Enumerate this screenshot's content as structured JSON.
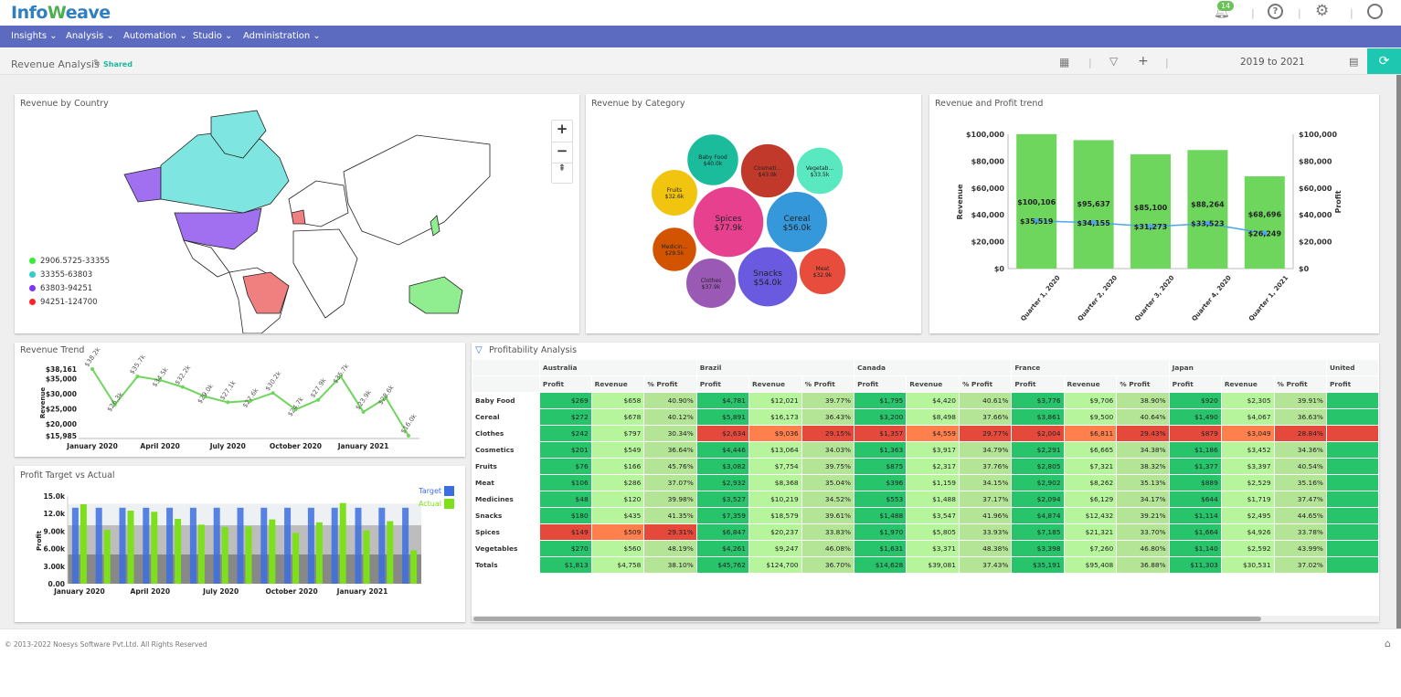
{
  "app": {
    "logo_text": "InfoWeave",
    "notification_count": "14",
    "icons": [
      "bell-icon",
      "help-icon",
      "settings-icon",
      "user-icon"
    ]
  },
  "nav": [
    "Insights",
    "Analysis",
    "Automation",
    "Studio",
    "Administration"
  ],
  "toolbar": {
    "title": "Revenue Analysis",
    "shared_label": "Shared",
    "date_range": "2019 to 2021",
    "icons": [
      "grid-icon",
      "filter-icon",
      "plus-icon",
      "calendar-icon",
      "refresh-icon"
    ]
  },
  "colors": {
    "nav": "#5c6bc0",
    "accent": "#1ec8b0",
    "revenue_bar": "#6ed65c",
    "profit_line": "#4da6e8",
    "target": "#3b6fe0",
    "actual": "#7ee01c"
  },
  "map": {
    "title": "Revenue by Country",
    "legend": [
      {
        "label": "2906.5725-33355",
        "color": "#33ee33"
      },
      {
        "label": "33355-63803",
        "color": "#33cccc"
      },
      {
        "label": "63803-94251",
        "color": "#7f33ff"
      },
      {
        "label": "94251-124700",
        "color": "#ff2222"
      }
    ],
    "zoom_in": "+",
    "zoom_out": "−"
  },
  "bubble": {
    "title": "Revenue by Category",
    "chart_data": {
      "type": "bubble",
      "items": [
        {
          "label": "Spices",
          "value_label": "$77.9k",
          "value": 77.9,
          "color": "#e6408f"
        },
        {
          "label": "Cereal",
          "value_label": "$56.0k",
          "value": 56.0,
          "color": "#3498db"
        },
        {
          "label": "Snacks",
          "value_label": "$54.0k",
          "value": 54.0,
          "color": "#6a5ae0"
        },
        {
          "label": "Cosmeti...",
          "value_label": "$43.9k",
          "value": 43.9,
          "color": "#c0392b"
        },
        {
          "label": "Baby Food",
          "value_label": "$40.0k",
          "value": 40.0,
          "color": "#1abc9c"
        },
        {
          "label": "Clothes",
          "value_label": "$37.9k",
          "value": 37.9,
          "color": "#9b59b6"
        },
        {
          "label": "Vegetab...",
          "value_label": "$33.5k",
          "value": 33.5,
          "color": "#5ae8c0"
        },
        {
          "label": "Meat",
          "value_label": "$32.9k",
          "value": 32.9,
          "color": "#e74c3c"
        },
        {
          "label": "Fruits",
          "value_label": "$32.6k",
          "value": 32.6,
          "color": "#f1c40f"
        },
        {
          "label": "Medicin...",
          "value_label": "$29.5k",
          "value": 29.5,
          "color": "#d35400"
        }
      ]
    }
  },
  "combo": {
    "title": "Revenue and Profit trend",
    "chart_data": {
      "type": "bar+line",
      "categories": [
        "Quarter 1, 2020",
        "Quarter 2, 2020",
        "Quarter 3, 2020",
        "Quarter 4, 2020",
        "Quarter 1, 2021"
      ],
      "series": [
        {
          "name": "Revenue",
          "type": "bar",
          "values": [
            100106,
            95637,
            85100,
            88264,
            68696
          ],
          "labels": [
            "$100,106",
            "$95,637",
            "$85,100",
            "$88,264",
            "$68,696"
          ]
        },
        {
          "name": "Profit",
          "type": "line",
          "values": [
            35519,
            34155,
            31273,
            33523,
            26249
          ],
          "labels": [
            "$35,519",
            "$34,155",
            "$31,273",
            "$33,523",
            "$26,249"
          ]
        }
      ],
      "ylabel": "Revenue",
      "y2label": "Profit",
      "ylim": [
        0,
        100000
      ],
      "yticks": [
        "$0",
        "$20,000",
        "$40,000",
        "$60,000",
        "$80,000",
        "$100,000"
      ]
    }
  },
  "trend": {
    "title": "Revenue Trend",
    "chart_data": {
      "type": "line",
      "x": [
        "2020-01",
        "2020-02",
        "2020-03",
        "2020-04",
        "2020-05",
        "2020-06",
        "2020-07",
        "2020-08",
        "2020-09",
        "2020-10",
        "2020-11",
        "2020-12",
        "2021-01",
        "2021-02",
        "2021-03"
      ],
      "values": [
        38161,
        26300,
        35700,
        34500,
        32200,
        29000,
        27100,
        27600,
        30200,
        24700,
        27900,
        35700,
        23900,
        28600,
        15985
      ],
      "labels": [
        "$38.2k",
        "$26.3k",
        "$35.7k",
        "$34.5k",
        "$32.2k",
        "$29.0k",
        "$27.1k",
        "$27.6k",
        "$30.2k",
        "$24.7k",
        "$27.9k",
        "$35.7k",
        "$23.9k",
        "$28.6k",
        "$16.0k"
      ],
      "ylabel": "Revenue",
      "ylim": [
        15985,
        38161
      ],
      "yticks": [
        "$15,985",
        "$20,000",
        "$25,000",
        "$30,000",
        "$35,000",
        "$38,161"
      ],
      "xticks": [
        "January 2020",
        "April 2020",
        "July 2020",
        "October 2020",
        "January 2021"
      ]
    }
  },
  "target": {
    "title": "Profit Target vs Actual",
    "chart_data": {
      "type": "bar",
      "x": [
        "2020-01",
        "2020-02",
        "2020-03",
        "2020-04",
        "2020-05",
        "2020-06",
        "2020-07",
        "2020-08",
        "2020-09",
        "2020-10",
        "2020-11",
        "2020-12",
        "2021-01",
        "2021-02",
        "2021-03"
      ],
      "series": [
        {
          "name": "Target",
          "values": [
            13000,
            13000,
            13000,
            13000,
            13000,
            13000,
            13000,
            13000,
            13000,
            13000,
            13000,
            13000,
            13000,
            13000,
            13000
          ]
        },
        {
          "name": "Actual",
          "values": [
            13600,
            9200,
            12500,
            12300,
            11100,
            10100,
            9700,
            9800,
            11000,
            8700,
            10500,
            13800,
            9100,
            10700,
            5700
          ]
        }
      ],
      "bands": [
        [
          0,
          5000
        ],
        [
          5000,
          10000
        ],
        [
          10000,
          13700
        ]
      ],
      "ylabel": "Profit",
      "ylim": [
        0,
        15000
      ],
      "yticks": [
        "0.00",
        "3.00k",
        "6.00k",
        "9.00k",
        "12.0k",
        "15.0k"
      ],
      "xticks": [
        "January 2020",
        "April 2020",
        "July 2020",
        "October 2020",
        "January 2021"
      ]
    }
  },
  "table": {
    "title": "Profitability Analysis",
    "countries": [
      "Australia",
      "Brazil",
      "Canada",
      "France",
      "Japan",
      "United"
    ],
    "subcols": [
      "Profit",
      "Revenue",
      "% Profit"
    ],
    "rows": [
      {
        "label": "Baby Food",
        "cells": [
          "$269",
          "$658",
          "40.90%",
          "$4,781",
          "$12,021",
          "39.77%",
          "$1,795",
          "$4,420",
          "40.61%",
          "$3,776",
          "$9,706",
          "38.90%",
          "$920",
          "$2,305",
          "39.91%",
          ""
        ]
      },
      {
        "label": "Cereal",
        "cells": [
          "$272",
          "$678",
          "40.12%",
          "$5,891",
          "$16,173",
          "36.43%",
          "$3,200",
          "$8,498",
          "37.66%",
          "$3,861",
          "$9,500",
          "40.64%",
          "$1,490",
          "$4,067",
          "36.63%",
          ""
        ]
      },
      {
        "label": "Clothes",
        "cells": [
          "$242",
          "$797",
          "30.34%",
          "$2,634",
          "$9,036",
          "29.15%",
          "$1,357",
          "$4,559",
          "29.77%",
          "$2,004",
          "$6,811",
          "29.43%",
          "$879",
          "$3,049",
          "28.84%",
          ""
        ]
      },
      {
        "label": "Cosmetics",
        "cells": [
          "$201",
          "$549",
          "36.64%",
          "$4,446",
          "$13,064",
          "34.03%",
          "$1,363",
          "$3,917",
          "34.79%",
          "$2,291",
          "$6,665",
          "34.38%",
          "$1,186",
          "$3,452",
          "34.36%",
          ""
        ]
      },
      {
        "label": "Fruits",
        "cells": [
          "$76",
          "$166",
          "45.76%",
          "$3,082",
          "$7,754",
          "39.75%",
          "$875",
          "$2,317",
          "37.76%",
          "$2,805",
          "$7,321",
          "38.32%",
          "$1,377",
          "$3,397",
          "40.54%",
          ""
        ]
      },
      {
        "label": "Meat",
        "cells": [
          "$106",
          "$286",
          "37.07%",
          "$2,932",
          "$8,368",
          "35.04%",
          "$396",
          "$1,159",
          "34.15%",
          "$2,902",
          "$8,262",
          "35.13%",
          "$889",
          "$2,529",
          "35.16%",
          ""
        ]
      },
      {
        "label": "Medicines",
        "cells": [
          "$48",
          "$120",
          "39.98%",
          "$3,527",
          "$10,219",
          "34.52%",
          "$553",
          "$1,488",
          "37.17%",
          "$2,094",
          "$6,129",
          "34.17%",
          "$644",
          "$1,719",
          "37.47%",
          ""
        ]
      },
      {
        "label": "Snacks",
        "cells": [
          "$180",
          "$435",
          "41.35%",
          "$7,359",
          "$18,579",
          "39.61%",
          "$1,488",
          "$3,547",
          "41.96%",
          "$4,874",
          "$12,432",
          "39.21%",
          "$1,114",
          "$2,495",
          "44.65%",
          ""
        ]
      },
      {
        "label": "Spices",
        "cells": [
          "$149",
          "$509",
          "29.31%",
          "$6,847",
          "$20,237",
          "33.83%",
          "$1,970",
          "$5,805",
          "33.93%",
          "$7,185",
          "$21,321",
          "33.70%",
          "$1,664",
          "$4,926",
          "33.78%",
          ""
        ]
      },
      {
        "label": "Vegetables",
        "cells": [
          "$270",
          "$560",
          "48.19%",
          "$4,261",
          "$9,247",
          "46.08%",
          "$1,631",
          "$3,371",
          "48.38%",
          "$3,398",
          "$7,260",
          "46.80%",
          "$1,140",
          "$2,592",
          "43.99%",
          ""
        ]
      },
      {
        "label": "Totals",
        "cells": [
          "$1,813",
          "$4,758",
          "38.10%",
          "$45,762",
          "$124,700",
          "36.70%",
          "$14,628",
          "$39,081",
          "37.43%",
          "$35,191",
          "$95,408",
          "36.88%",
          "$11,303",
          "$30,531",
          "37.02%",
          ""
        ]
      }
    ],
    "low_profit": {
      "Australia": "Spices",
      "Brazil": "Clothes",
      "Canada": "Clothes",
      "France": "Clothes",
      "Japan": "Clothes",
      "United": "Clothes"
    }
  },
  "footer": {
    "copyright": "© 2013-2022 Noesys Software Pvt.Ltd. All Rights Reserved"
  }
}
